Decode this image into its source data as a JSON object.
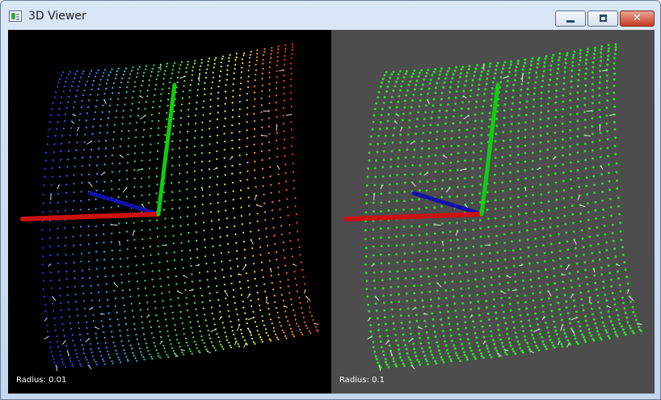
{
  "window": {
    "title": "3D Viewer",
    "icon": "app-window-icon",
    "controls": {
      "minimize_icon": "minimize-icon",
      "maximize_icon": "maximize-icon",
      "close_icon": "close-icon",
      "close_glyph": "✕"
    }
  },
  "viewports": [
    {
      "background": "#000000",
      "color_mode": "axis-gradient",
      "radius_label": "Radius: 0.01"
    },
    {
      "background": "#4d4d4d",
      "color_mode": "single-color",
      "point_color": "#22ee22",
      "radius_label": "Radius: 0.1"
    }
  ],
  "axes": {
    "x_color": "#cc1111",
    "y_color": "#11cc11",
    "z_color": "#1111aa"
  },
  "normals_color": "#ffffff",
  "gradient_colors": [
    "#2030ff",
    "#20c0ff",
    "#30ff30",
    "#ffff20",
    "#ff2020"
  ]
}
